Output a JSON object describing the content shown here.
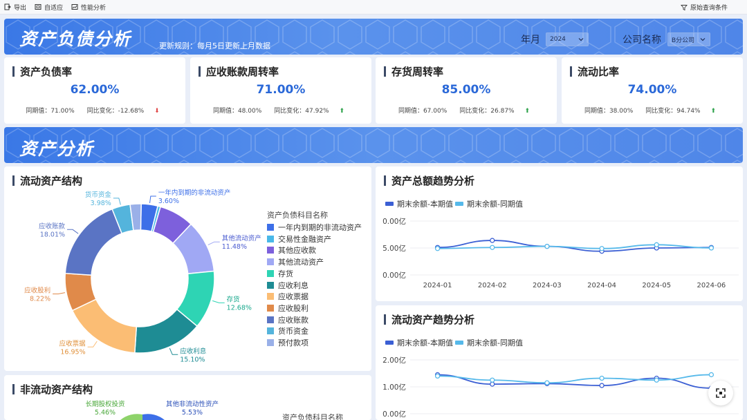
{
  "toolbar": {
    "export": "导出",
    "adaptive": "自适应",
    "perf": "性能分析",
    "query": "原始查询条件"
  },
  "header": {
    "title": "资产负债分析",
    "rule": "更新规则：每月5日更新上月数据",
    "year_label": "年月",
    "year_value": "2024",
    "company_label": "公司名称",
    "company_value": "B分公司"
  },
  "kpis": [
    {
      "title": "资产负债率",
      "value": "62.00%",
      "prev_label": "同期值：71.00%",
      "chg_label": "同比变化：-12.68%",
      "dir": "down"
    },
    {
      "title": "应收账款周转率",
      "value": "71.00%",
      "prev_label": "同期值：48.00%",
      "chg_label": "同比变化：47.92%",
      "dir": "up"
    },
    {
      "title": "存货周转率",
      "value": "85.00%",
      "prev_label": "同期值：67.00%",
      "chg_label": "同比变化：26.87%",
      "dir": "up"
    },
    {
      "title": "流动比率",
      "value": "74.00%",
      "prev_label": "同期值：38.00%",
      "chg_label": "同比变化：94.74%",
      "dir": "up"
    }
  ],
  "section": {
    "title": "资产分析"
  },
  "panels": {
    "current_assets": "流动资产结构",
    "total_trend": "资产总额趋势分析",
    "current_trend": "流动资产趋势分析",
    "noncurrent": "非流动资产结构"
  },
  "colors": {
    "accent": "#2a68d8",
    "banner": "#3a78e6",
    "series_current": "#3b5fd4",
    "series_prior": "#56b9ea"
  },
  "chart_data": [
    {
      "type": "pie",
      "title": "流动资产结构",
      "legend_title": "资产负债科目名称",
      "categories": [
        "一年内到期的非流动资产",
        "交易性金融资产",
        "其他应收款",
        "其他流动资产",
        "存货",
        "应收利息",
        "应收票据",
        "应收股利",
        "应收账款",
        "货币资金",
        "预付款项"
      ],
      "values": [
        3.6,
        0.6,
        7.6,
        11.48,
        12.68,
        15.1,
        16.95,
        8.22,
        18.01,
        3.98,
        2.4
      ],
      "colors": [
        "#3d6fe8",
        "#49b8e8",
        "#7d60dc",
        "#a0a8f4",
        "#2ed4b4",
        "#1e8c94",
        "#fbbd74",
        "#e08a4a",
        "#5a74c4",
        "#54b4dc",
        "#9ab0e8"
      ],
      "labels": [
        {
          "name": "一年内到期的非流动资产",
          "pct": "3.60%"
        },
        {
          "name": "其他流动资产",
          "pct": "11.48%"
        },
        {
          "name": "存货",
          "pct": "12.68%"
        },
        {
          "name": "应收利息",
          "pct": "15.10%"
        },
        {
          "name": "应收票据",
          "pct": "16.95%"
        },
        {
          "name": "应收股利",
          "pct": "8.22%"
        },
        {
          "name": "应收账款",
          "pct": "18.01%"
        },
        {
          "name": "货币资金",
          "pct": "3.98%"
        }
      ]
    },
    {
      "type": "line",
      "title": "资产总额趋势分析",
      "x": [
        "2024-01",
        "2024-02",
        "2024-03",
        "2024-04",
        "2024-05",
        "2024-06"
      ],
      "yticks": [
        "0.00亿",
        "5.00亿",
        "0.00亿"
      ],
      "series": [
        {
          "name": "期末余额-本期值",
          "values": [
            5.1,
            6.4,
            5.3,
            4.4,
            5.0,
            5.1
          ]
        },
        {
          "name": "期末余额-同期值",
          "values": [
            4.9,
            5.1,
            5.3,
            4.9,
            5.6,
            5.0
          ]
        }
      ]
    },
    {
      "type": "line",
      "title": "流动资产趋势分析",
      "x": [
        "2024-01",
        "2024-02",
        "2024-03",
        "2024-04",
        "2024-05",
        "2024-06"
      ],
      "yticks": [
        "2.00亿",
        "1.00亿",
        "0.00亿"
      ],
      "series": [
        {
          "name": "期末余额-本期值",
          "values": [
            1.45,
            1.1,
            1.12,
            1.05,
            1.32,
            0.95
          ]
        },
        {
          "name": "期末余额-同期值",
          "values": [
            1.4,
            1.25,
            1.15,
            1.32,
            1.25,
            1.45
          ]
        }
      ]
    },
    {
      "type": "pie",
      "title": "非流动资产结构",
      "legend_title": "资产负债科目名称",
      "labels": [
        {
          "name": "长期股权投资",
          "pct": "5.46%"
        },
        {
          "name": "其他非流动性资产",
          "pct": "5.53%"
        }
      ]
    }
  ]
}
